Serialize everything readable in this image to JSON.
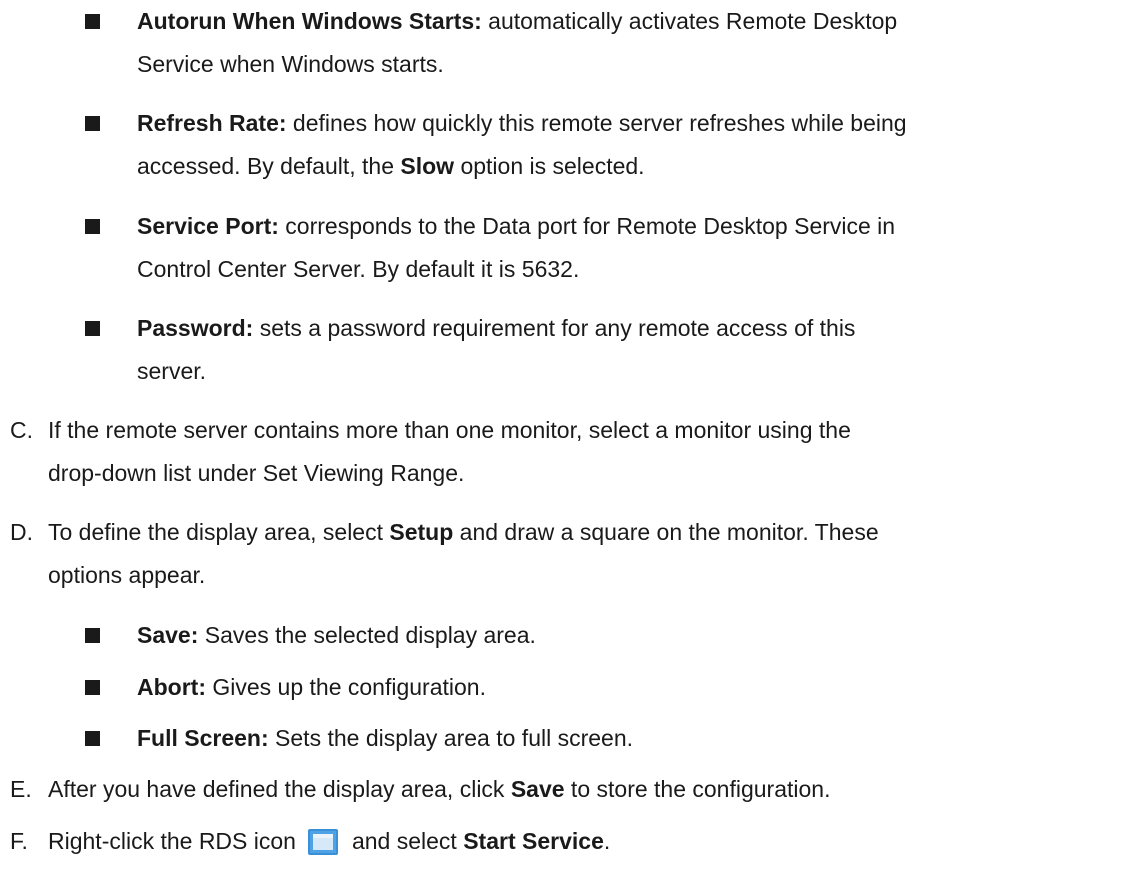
{
  "option_bullets": [
    {
      "term": "Autorun When Windows Starts:",
      "pre": " automatically activates Remote Desktop",
      "line2": "Service when Windows starts."
    },
    {
      "term": "Refresh Rate:",
      "pre": " defines how quickly this remote server refreshes while being",
      "line2_a": "accessed. By default, the ",
      "line2_b": "Slow",
      "line2_c": " option is selected."
    },
    {
      "term": "Service Port:",
      "pre": " corresponds to the Data port for Remote Desktop Service in",
      "line2": "Control Center Server. By default it is 5632."
    },
    {
      "term": "Password:",
      "pre": " sets a password requirement for any remote access of this",
      "line2": "server."
    }
  ],
  "step_c": {
    "letter": "C.",
    "line1": "If the remote server contains more than one monitor, select a monitor using the",
    "line2": "drop-down list under Set Viewing Range."
  },
  "step_d": {
    "letter": "D.",
    "pre": "To define the display area, select ",
    "bold": "Setup",
    "post": " and draw a square on the monitor. These",
    "line2": "options appear."
  },
  "setup_bullets": [
    {
      "term": "Save:",
      "text": " Saves the selected display area."
    },
    {
      "term": "Abort:",
      "text": " Gives up the configuration."
    },
    {
      "term": "Full Screen:",
      "text": " Sets the display area to full screen."
    }
  ],
  "step_e": {
    "letter": "E.",
    "pre": "After you have defined the display area, click ",
    "bold": "Save",
    "post": " to store the configuration."
  },
  "step_f": {
    "letter": "F.",
    "pre": "Right-click the RDS icon",
    "mid": "and select ",
    "bold": "Start Service",
    "post": ".",
    "icon": "rds-app-icon"
  },
  "colors": {
    "text": "#1a1a1a",
    "icon_blue": "#3a8fd6"
  }
}
